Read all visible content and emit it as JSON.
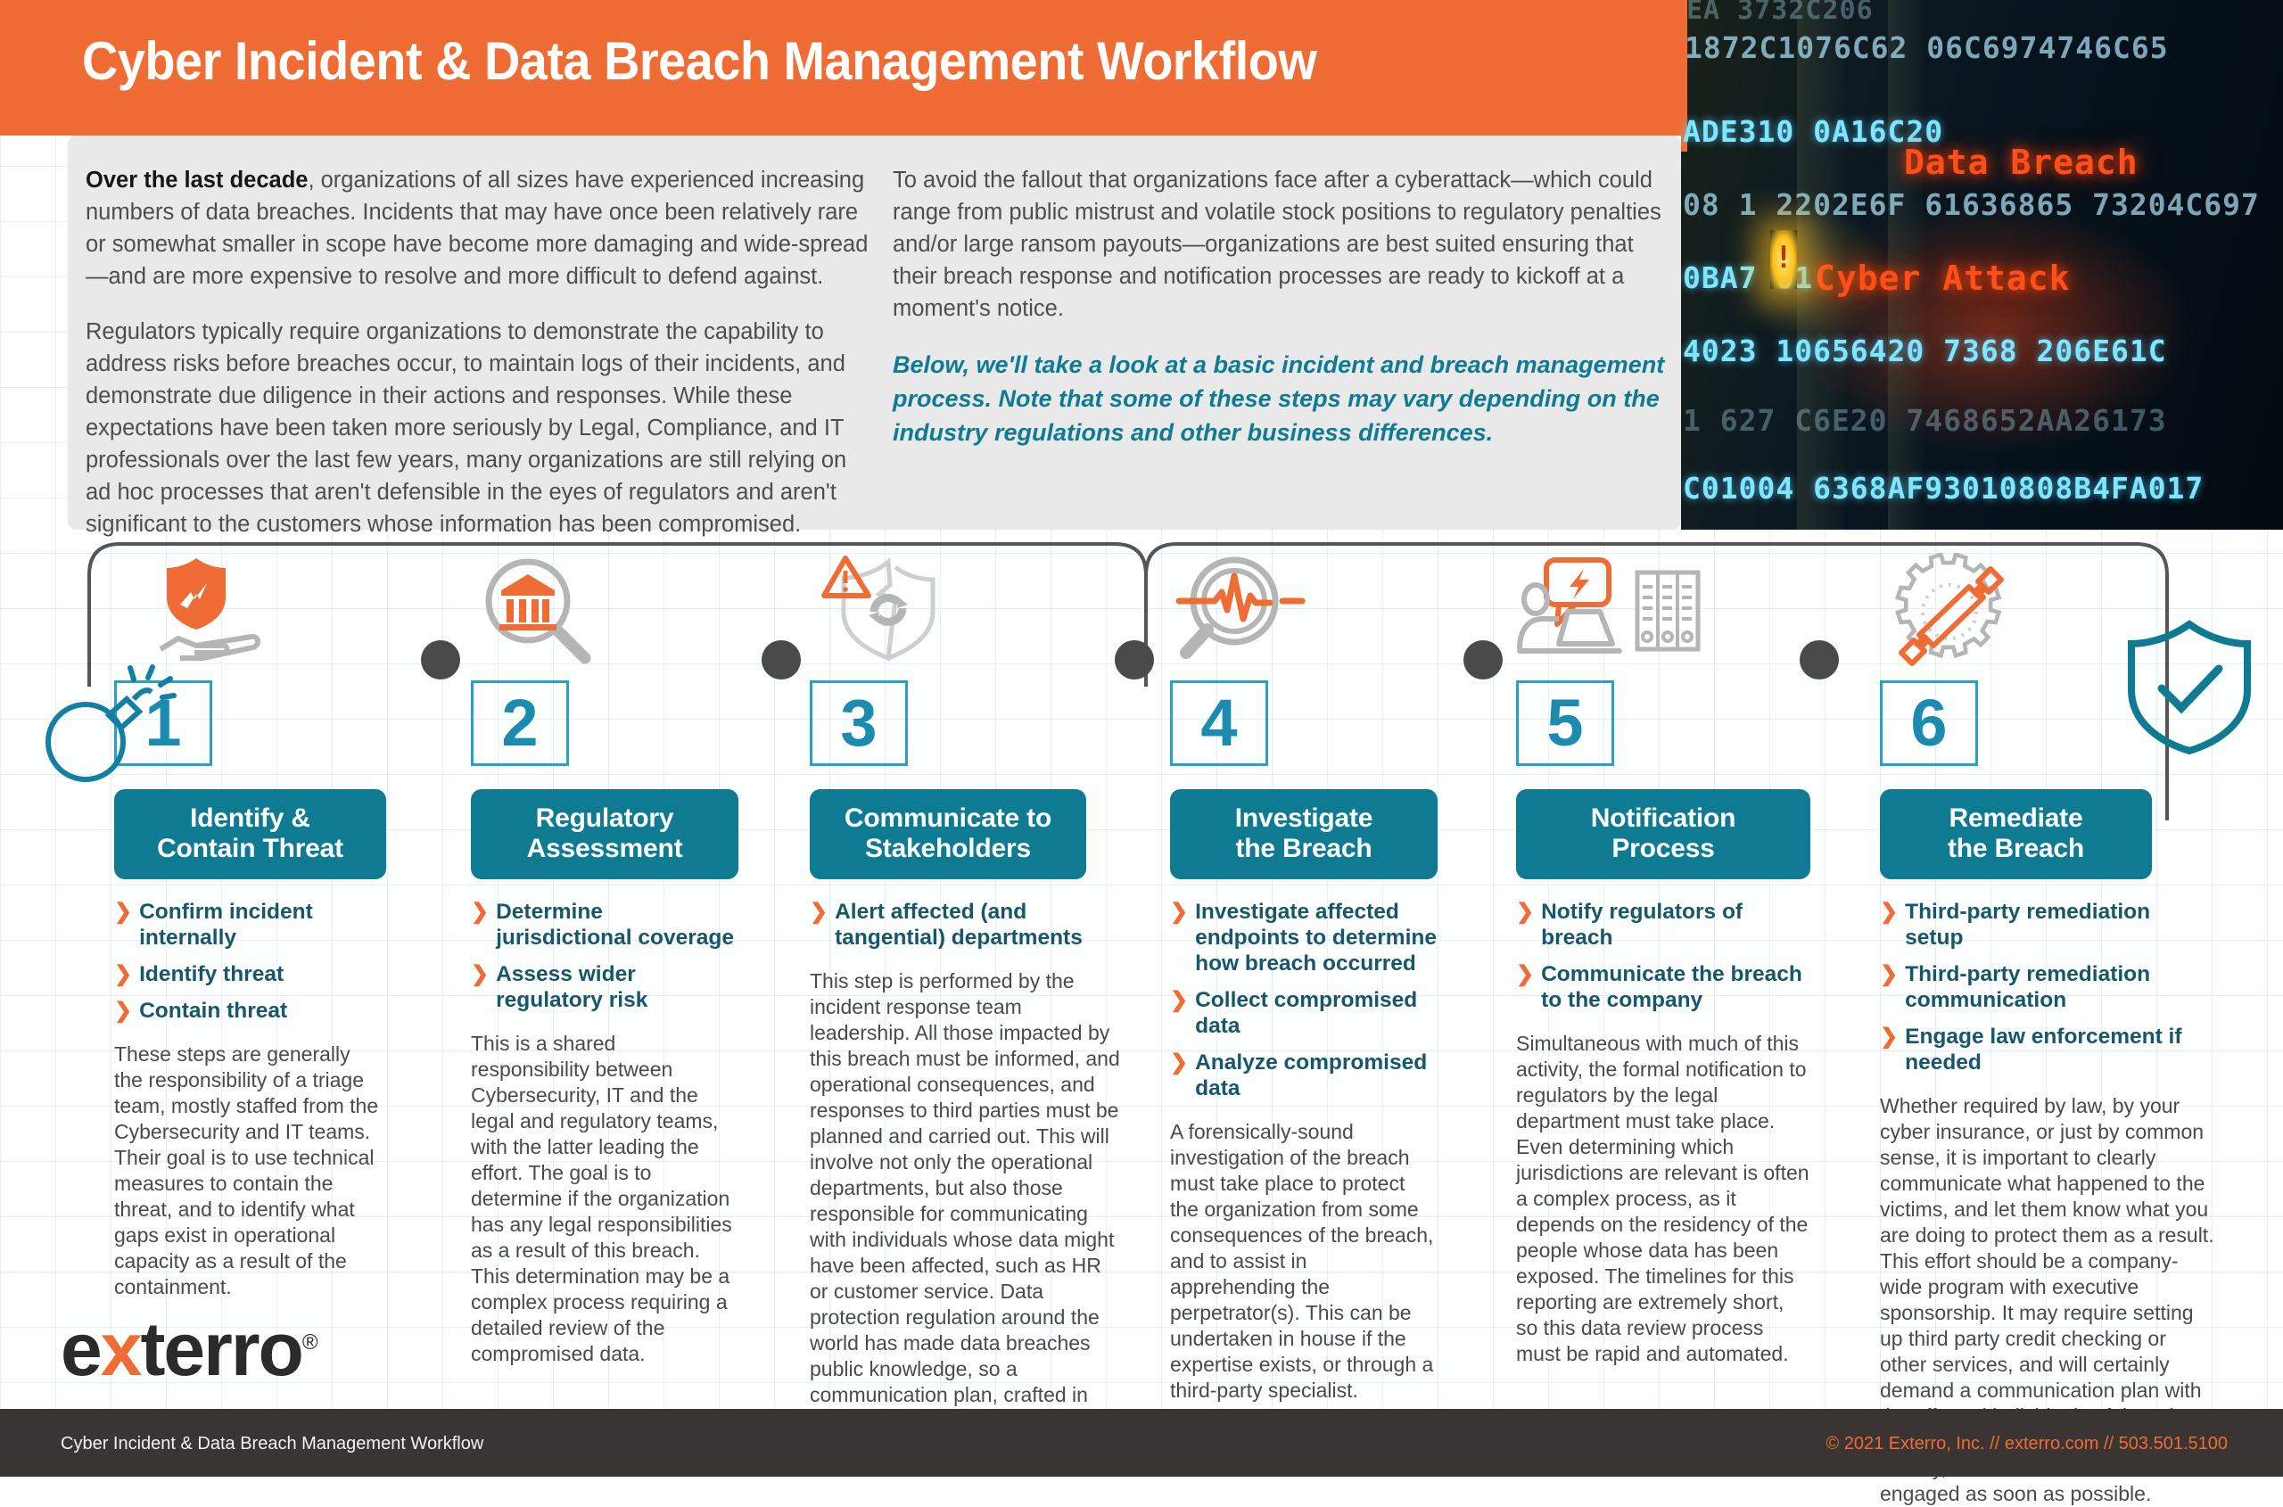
{
  "header": {
    "title": "Cyber Incident & Data Breach Management Workflow",
    "accent_orange": "#ef6c35",
    "teal": "#0e7b93",
    "number_teal": "#1b8cb0",
    "bullet_text_teal": "#17566b",
    "footer_bg": "#3a3533",
    "panel_bg": "#e9e9e9"
  },
  "hero": {
    "alert_label_1": "Data Breach",
    "alert_label_2": "Cyber Attack",
    "warning_glyph": "!",
    "hex_rows": [
      "EA     3732C206",
      "1872C1076C62 06C6974746C65",
      "ADE310 0A16C20",
      "08 1 2202E6F 61636865 73204C697",
      "0BA7 01",
      "4023 10656420 7368  206E61C",
      "1  627     C6E20 7468652AA26173",
      "C01004 6368AF93010808B4FA017"
    ]
  },
  "intro": {
    "left": [
      {
        "lead": "Over the last decade",
        "rest": ", organizations of all sizes have experienced increasing numbers of data breaches. Incidents that may have once been relatively rare or somewhat smaller in scope have become more damaging and wide-spread—and are more expensive to resolve and more difficult to defend against."
      },
      {
        "lead": "",
        "rest": "Regulators typically require organizations to demonstrate the capability to address risks before breaches occur, to maintain logs of their incidents, and demonstrate due diligence in their actions and responses. While these expectations have been taken more seriously by Legal, Compliance, and IT professionals over the last few years, many organizations are still relying on ad hoc processes that aren't defensible in the eyes of regulators and aren't significant to the customers whose information has been compromised."
      }
    ],
    "right_paragraph": "To avoid the fallout that organizations face after a cyberattack—which could range from public mistrust and volatile stock positions to regulatory penalties and/or large ransom payouts—organizations are best suited ensuring that their breach response and notification processes are ready to kickoff at a moment's notice.",
    "teal_lead": "Below,",
    "teal_rest": " we'll take a look at a basic incident and breach management process. Note that some of these steps may vary depending on the industry regulations and other business differences."
  },
  "flow": {
    "start_icon": "bomb-icon",
    "end_icon": "shield-check-icon",
    "connector_dots": 5
  },
  "steps": [
    {
      "number": "1",
      "icon": "shield-bolt-on-hand-icon",
      "title_line1": "Identify &",
      "title_line2": "Contain Threat",
      "bullets": [
        "Confirm incident internally",
        "Identify threat",
        "Contain threat"
      ],
      "body": "These steps are generally the responsibility of a triage team, mostly staffed from the Cybersecurity and IT teams. Their goal is to use technical measures to contain the threat, and to identify what gaps exist in operational capacity as a result of the containment."
    },
    {
      "number": "2",
      "icon": "magnifier-courthouse-icon",
      "title_line1": "Regulatory",
      "title_line2": "Assessment",
      "bullets": [
        "Determine jurisdictional coverage",
        "Assess wider regulatory risk"
      ],
      "body": "This is a shared responsibility between Cybersecurity, IT and the legal and regulatory teams, with the latter leading the effort. The goal is to determine if the organization has any legal responsibilities as a result of this breach. This determination may be a complex process requiring a detailed review of the compromised data."
    },
    {
      "number": "3",
      "icon": "broken-shield-warning-icon",
      "title_line1": "Communicate to",
      "title_line2": "Stakeholders",
      "bullets": [
        "Alert affected (and tangential) departments"
      ],
      "body": "This step is performed by the incident response team leadership. All those impacted by this breach must be informed, and operational consequences, and responses to third parties must be planned and carried out. This will involve not only the operational departments, but also those responsible for communicating with individuals whose data might have been affected, such as HR or customer service. Data protection regulation around the world has made data breaches public knowledge, so a communication plan, crafted in conjunction with corporate communications, is crucial."
    },
    {
      "number": "4",
      "icon": "magnifier-pulse-icon",
      "title_line1": "Investigate",
      "title_line2": "the Breach",
      "bullets": [
        "Investigate affected endpoints to determine how breach occurred",
        "Collect compromised data",
        "Analyze compromised data"
      ],
      "body": "A forensically-sound investigation of the breach must take place to protect the organization from some consequences of the breach, and to assist in apprehending the perpetrator(s). This can be undertaken in house if the expertise exists, or through a third-party specialist."
    },
    {
      "number": "5",
      "icon": "person-laptop-bolt-bubble-binders-icon",
      "title_line1": "Notification",
      "title_line2": "Process",
      "bullets": [
        "Notify regulators of breach",
        "Communicate the breach to the company"
      ],
      "body": "Simultaneous with much of this activity, the formal notification to regulators by the legal department must take place. Even determining which jurisdictions are relevant is often a complex process, as it depends on the residency of the people whose data has been exposed. The timelines for this reporting are extremely short, so this data review process must be rapid and automated."
    },
    {
      "number": "6",
      "icon": "gear-wrench-icon",
      "title_line1": "Remediate",
      "title_line2": "the Breach",
      "bullets": [
        "Third-party remediation setup",
        "Third-party remediation communication",
        "Engage law enforcement if needed"
      ],
      "body": "Whether required by law, by your cyber insurance, or just by common sense, it is important to clearly communicate what happened to the victims, and let them know what you are doing to protect them as a result. This effort should be a company-wide program with executive sponsorship. It may require setting up third party credit checking or other services, and will certainly demand a communication plan with the affected individuals. If there is any indication of possible criminal activity, law enforcement should be engaged as soon as possible."
    }
  ],
  "logo": {
    "part1": "e",
    "part_x": "x",
    "part2": "terro",
    "registered": "®"
  },
  "footer": {
    "left": "Cyber Incident & Data Breach Management Workflow",
    "right": "© 2021 Exterro, Inc. // exterro.com // 503.501.5100"
  }
}
